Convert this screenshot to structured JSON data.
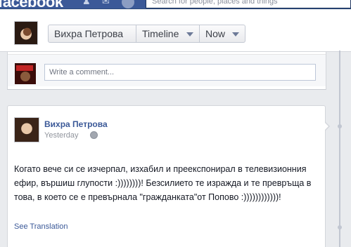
{
  "topbar": {
    "logo": "facebook",
    "search_placeholder": "Search for people, places and things",
    "icons": [
      "friends-icon",
      "messages-icon",
      "notifications-icon"
    ]
  },
  "header": {
    "name_button": "Вихра Петрова",
    "timeline_button": "Timeline",
    "now_button": "Now"
  },
  "comment_box": {
    "placeholder": "Write a comment..."
  },
  "post": {
    "author": "Вихра Петрова",
    "time": "Yesterday",
    "text": "Когато вече си се изчерпал, изхабил и преекспонирал в телевизионния ефир, вършиш глупости :))))))))! Безсилието те изражда и те превръща в това, в което се е превърнала \"гражданката\"от Попово :))))))))))))!",
    "see_translation": "See Translation"
  },
  "colors": {
    "brand": "#3b5998",
    "page_bg": "#e9ebee",
    "link": "#3b5998"
  }
}
